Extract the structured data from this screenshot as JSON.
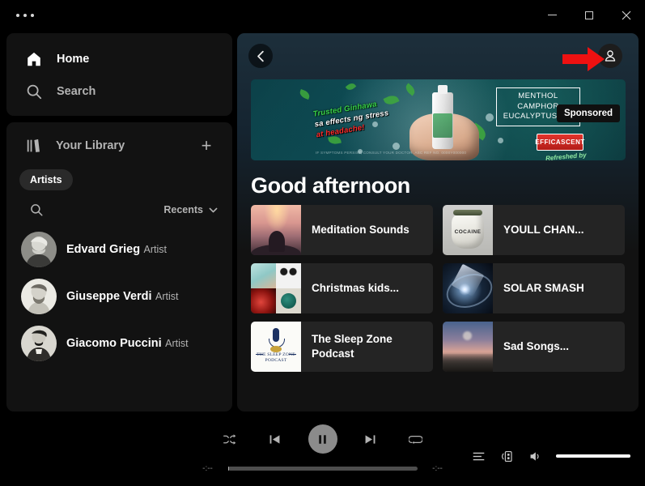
{
  "window": {
    "menu_icon": "overflow-dots-icon",
    "minimize_label": "Minimize",
    "maximize_label": "Maximize",
    "close_label": "Close"
  },
  "sidebar": {
    "nav": [
      {
        "label": "Home",
        "icon": "home-icon",
        "active": true
      },
      {
        "label": "Search",
        "icon": "search-icon",
        "active": false
      }
    ],
    "library": {
      "title": "Your Library",
      "icon": "library-icon",
      "add_label": "+",
      "filters": [
        {
          "label": "Artists",
          "active": true
        }
      ],
      "search_icon": "search-icon",
      "sort_label": "Recents",
      "sort_caret": "chevron-down-icon",
      "items": [
        {
          "name": "Edvard Grieg",
          "type": "Artist",
          "art": "avatar-grieg"
        },
        {
          "name": "Giuseppe Verdi",
          "type": "Artist",
          "art": "avatar-verdi"
        },
        {
          "name": "Giacomo Puccini",
          "type": "Artist",
          "art": "avatar-puccini"
        }
      ]
    }
  },
  "main": {
    "back_label": "Back",
    "profile_label": "Profile",
    "annotation": {
      "type": "red-arrow",
      "points_to": "profile-button",
      "color": "#ee1111"
    },
    "advert": {
      "sponsored_label": "Sponsored",
      "claim_line1": "Trusted Ginhawa",
      "claim_line2": "sa effects ng stress",
      "claim_line3": "at headache!",
      "claim_highlight": "stress",
      "ingredients": "MENTHOL\nCAMPHOR\nEUCALYPTUS OIL",
      "ingredient_lines": [
        "MENTHOL",
        "CAMPHOR",
        "EUCALYPTUS OIL"
      ],
      "brand": "EFFICASCENT",
      "brand_tagline": "Refreshed by",
      "fine_print": "IF SYMPTOMS PERSIST, CONSULT YOUR DOCTOR.  ASC REF NO. 0000Y000000"
    },
    "greeting": "Good afternoon",
    "cards": [
      {
        "title": "Meditation Sounds",
        "art": "art-meditation"
      },
      {
        "title": "YOULL CHAN...",
        "art": "art-jar",
        "art_text": "COCAINE"
      },
      {
        "title": "Christmas kids...",
        "art": "art-collage"
      },
      {
        "title": "SOLAR SMASH",
        "art": "art-solar"
      },
      {
        "title": "The Sleep Zone Podcast",
        "art": "art-podcast",
        "art_line1": "THE SLEEP ZONE",
        "art_line2": "PODCAST"
      },
      {
        "title": "Sad Songs...",
        "art": "art-sad"
      }
    ]
  },
  "player": {
    "shuffle_label": "Shuffle",
    "previous_label": "Previous",
    "play_pause_label": "Pause",
    "play_state": "playing",
    "next_label": "Next",
    "repeat_label": "Repeat",
    "elapsed_time": "-:--",
    "total_time": "-:--",
    "progress_percent": 0,
    "queue_label": "Queue",
    "devices_label": "Connect to a device",
    "volume_label": "Mute",
    "volume_percent": 100
  }
}
